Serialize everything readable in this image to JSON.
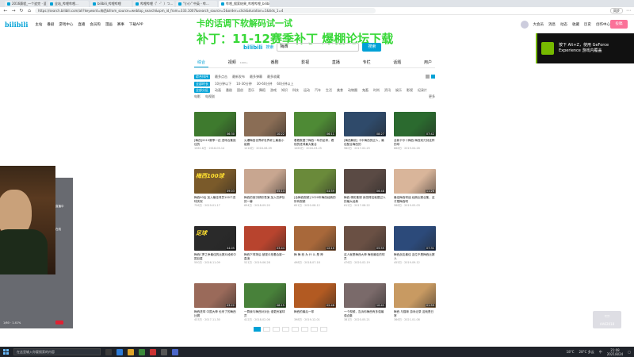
{
  "browser": {
    "tabs": [
      {
        "label": "2016赛程_一个追完 · 篮个追中"
      },
      {
        "label": "全站_哔哩哔哩..."
      },
      {
        "label": "bilibili_哔哩哔哩"
      },
      {
        "label": "哔哩哔哩（゜-゜）つ..."
      },
      {
        "label": "\"小小\" 中英 - 哔..."
      },
      {
        "label": "哔哩_搜索结果_哔哩哔哩_bilibili",
        "active": true
      }
    ],
    "url": "https://search.bilibili.com/all?keyword=梅西&from_source=webtop_search&spm_id_from=333.1007&search_source=5&order=click&duration=1&tids_1=4",
    "sync_label": "同步"
  },
  "site": {
    "logo": "bilibili",
    "nav": [
      "主站",
      "番剧",
      "游戏中心",
      "直播",
      "会员购",
      "漫画",
      "赛事",
      "下载APP"
    ],
    "user_links": [
      "大会员",
      "消息",
      "动态",
      "收藏",
      "历史",
      "创作中心"
    ],
    "upload_label": "投稿"
  },
  "overlay": {
    "line1": "卡的话调下软解码试一试",
    "line2": "补丁：11-12赛季补丁 爆棚论坛下载"
  },
  "search": {
    "logo": "bilibili",
    "logo_sub": "搜索",
    "query": "梅西",
    "button": "搜索"
  },
  "category_tabs": [
    {
      "label": "综合",
      "active": true
    },
    {
      "label": "视频",
      "count": "1000+"
    },
    {
      "label": "番剧"
    },
    {
      "label": "影视"
    },
    {
      "label": "直播"
    },
    {
      "label": "专栏"
    },
    {
      "label": "话题"
    },
    {
      "label": "用户"
    }
  ],
  "filters": {
    "order": [
      "综合排序",
      "最多点击",
      "最新发布",
      "最多弹幕",
      "最多收藏"
    ],
    "duration": [
      "全部时长",
      "10分钟以下",
      "10-30分钟",
      "30-60分钟",
      "60分钟以上"
    ],
    "zones": [
      "全部分区",
      "动画",
      "番剧",
      "国创",
      "音乐",
      "舞蹈",
      "游戏",
      "知识",
      "科技",
      "运动",
      "汽车",
      "生活",
      "美食",
      "动物圈",
      "鬼畜",
      "时尚",
      "资讯",
      "娱乐",
      "影视",
      "纪录片",
      "电影",
      "电视剧"
    ],
    "more": "更多"
  },
  "videos": [
    {
      "title": "[梅西]2015赛季一边 进球合集绝佳的",
      "dur": "06:30",
      "meta": "1561.8万 · 2018-03-14",
      "cap": ""
    },
    {
      "title": "火爆梅西世界杯世界杯上最高小组赛",
      "dur": "10:22",
      "meta": "1216万 · 2016-06-09",
      "cap": ""
    },
    {
      "title": "看着数据了梅西一年的足球，看他的进球最大集合",
      "dur": "06:11",
      "meta": "1063万 · 2016-03-25",
      "cap": ""
    },
    {
      "title": "[梅西解说] 卡中梅西的过人，最佳配合梅西的",
      "dur": "08:27",
      "meta": "980万 · 2017-02-25",
      "cap": ""
    },
    {
      "title": "全新卡尔十梅西 梅西双刃剑这样的球",
      "dur": "07:42",
      "meta": "866万 · 2019-04-26",
      "cap": ""
    },
    {
      "title": "梅西90后 加入最佳球员100个进球庆祝",
      "dur": "09:03",
      "meta": "756万 · 2019-01-17",
      "cap": "梅西100球"
    },
    {
      "title": "梅西的首次精彩表演 加入巴萨队的一幕",
      "dur": "05:14",
      "meta": "694万 · 2018-09-20",
      "cap": ""
    },
    {
      "title": "[全梅西视频] 2020年梅西经典的所有视频",
      "dur": "04:59",
      "meta": "651万 · 2020-08-12",
      "cap": ""
    },
    {
      "title": "梅西 精彩集锦 我觉得这就是过人的最大经典",
      "dur": "06:48",
      "meta": "612万 · 2017-08-22",
      "cap": ""
    },
    {
      "title": "最佳梅西球迷 经典比赛合集，这才是梅西吧",
      "dur": "11:26",
      "meta": "588万 · 2019-05-03",
      "cap": ""
    },
    {
      "title": "梅西C罗之争最佳的比赛片段和中国巨星",
      "dur": "04:05",
      "meta": "550万 · 2016-11-09",
      "cap": "足球"
    },
    {
      "title": "梅西下球场后 被观众抢着合影一直追",
      "dur": "03:44",
      "meta": "521万 · 2019-06-28",
      "cap": ""
    },
    {
      "title": "梅 梅 西 为 什 么 是 神",
      "dur": "12:10",
      "meta": "498万 · 2018-07-18",
      "cap": ""
    },
    {
      "title": "这人就是梅西大神 梅西最佳的球员",
      "dur": "05:55",
      "meta": "476万 · 2020-02-19",
      "cap": ""
    },
    {
      "title": "梅西战友最佳 这位不是梅西比赛人",
      "dur": "07:31",
      "meta": "455万 · 2019-09-12",
      "cap": ""
    },
    {
      "title": "梅西进球 中国大神 也来了的梅西比赛",
      "dur": "03:22",
      "meta": "433万 · 2017-11-30",
      "cap": ""
    },
    {
      "title": "一群我与梅西对对比 谁更厉害球员",
      "dur": "08:15",
      "meta": "412万 · 2018-02-06",
      "cap": ""
    },
    {
      "title": "梅西的最后一球",
      "dur": "02:48",
      "meta": "398万 · 2019-12-01",
      "cap": ""
    },
    {
      "title": "一个视频，告诉你梅西有多强最强合集",
      "dur": "10:41",
      "meta": "381万 · 2020-05-21",
      "cap": ""
    },
    {
      "title": "梅西 与猫咪 游戏记录 这就是日常",
      "dur": "01:59",
      "meta": "366万 · 2021-01-08",
      "cap": ""
    }
  ],
  "thumb_colors": [
    "#3e7a2e",
    "#8a6d55",
    "#4e8a35",
    "#2f4a6a",
    "#2b6a2f",
    "#7a5a2a",
    "#c8a690",
    "#6a8a3a",
    "#5a4a44",
    "#d9b59a",
    "#2a2a2a",
    "#b8442e",
    "#a8683a",
    "#6a5044",
    "#2c4a7a",
    "#9a6a5a",
    "#48813a",
    "#b25a22",
    "#7a6a6a",
    "#c89a62"
  ],
  "pagination": {
    "current": 1,
    "pages": [
      "1",
      "2",
      "3",
      "4",
      "5",
      "6",
      "7",
      "8"
    ]
  },
  "nvidia": {
    "text": "按下 Alt+Z，使用 GeForce Experience 游戏内覆盖"
  },
  "webcam_panel": {
    "label1": "直播中",
    "label2": "在线",
    "stat": "1/60 · 1.41%"
  },
  "watermark": {
    "text": "AA62018"
  },
  "taskbar": {
    "search_placeholder": "在这里输入你要搜索的内容",
    "weather": "28°C 多云",
    "time": "21:08",
    "date": "2021/8/24",
    "temp": "18°C",
    "lang": "中"
  }
}
